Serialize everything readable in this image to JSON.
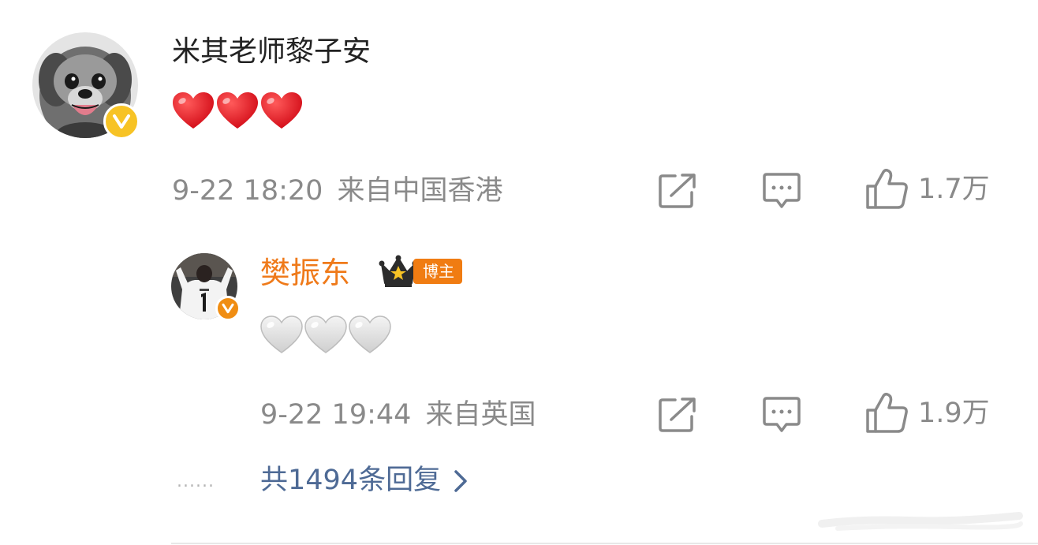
{
  "main_comment": {
    "username": "米其老师黎子安",
    "verified": true,
    "emoji": [
      "red-heart",
      "red-heart",
      "red-heart"
    ],
    "date": "9-22 18:20",
    "location": "来自中国香港",
    "like_count": "1.7万"
  },
  "reply": {
    "username": "樊振东",
    "verified": true,
    "badge_label": "博主",
    "emoji": [
      "white-heart",
      "white-heart",
      "white-heart"
    ],
    "date": "9-22 19:44",
    "location": "来自英国",
    "like_count": "1.9万"
  },
  "reply_summary": {
    "dots": "......",
    "label": "共1494条回复"
  },
  "colors": {
    "username_main": "#222222",
    "username_reply": "#ef7a1a",
    "meta_gray": "#8a8a8a",
    "link_blue": "#4e6a95",
    "verified_yellow": "#f7c325",
    "badge_orange": "#f07c12",
    "heart_red": "#e02020"
  }
}
